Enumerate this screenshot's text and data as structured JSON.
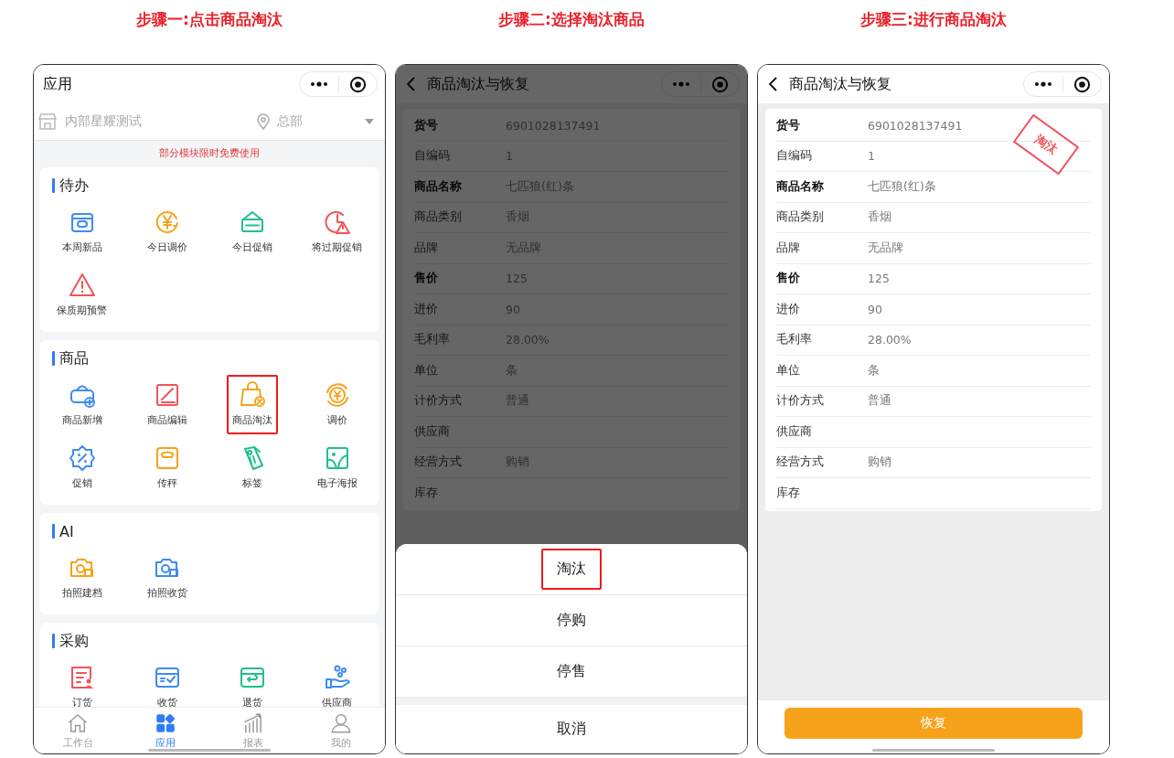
{
  "screens": [
    {
      "step_title": "步骤一:点击商品淘汰",
      "kind": "app_menu",
      "header": {
        "title": "应用"
      },
      "store": "内部星耀测试",
      "location": "总部",
      "notice": "部分模块限时免费使用",
      "sections": [
        {
          "title": "待办",
          "items": [
            {
              "label": "本周新品",
              "highlighted": false
            },
            {
              "label": "今日调价",
              "highlighted": false
            },
            {
              "label": "今日促销",
              "highlighted": false
            },
            {
              "label": "将过期促销",
              "highlighted": false
            },
            {
              "label": "保质期预警",
              "highlighted": false
            }
          ]
        },
        {
          "title": "商品",
          "items": [
            {
              "label": "商品新增",
              "highlighted": false
            },
            {
              "label": "商品编辑",
              "highlighted": false
            },
            {
              "label": "商品淘汰",
              "highlighted": true
            },
            {
              "label": "调价",
              "highlighted": false
            },
            {
              "label": "促销",
              "highlighted": false
            },
            {
              "label": "传秤",
              "highlighted": false
            },
            {
              "label": "标签",
              "highlighted": false
            },
            {
              "label": "电子海报",
              "highlighted": false
            }
          ]
        },
        {
          "title": "AI",
          "items": [
            {
              "label": "拍照建档",
              "highlighted": false
            },
            {
              "label": "拍照收货",
              "highlighted": false
            }
          ]
        },
        {
          "title": "采购",
          "items": [
            {
              "label": "订货",
              "highlighted": false
            },
            {
              "label": "收货",
              "highlighted": false
            },
            {
              "label": "退货",
              "highlighted": false
            },
            {
              "label": "供应商",
              "highlighted": false
            }
          ]
        }
      ],
      "tabbar": [
        {
          "label": "工作台",
          "selected": false
        },
        {
          "label": "应用",
          "selected": true
        },
        {
          "label": "报表",
          "selected": false
        },
        {
          "label": "我的",
          "selected": false
        }
      ]
    },
    {
      "step_title": "步骤二:选择淘汰商品",
      "kind": "product_detail",
      "header": {
        "title": "商品淘汰与恢复"
      },
      "dimmed": true,
      "fields": [
        {
          "label": "货号",
          "value": "6901028137491",
          "bold": true
        },
        {
          "label": "自编码",
          "value": "1",
          "bold": false
        },
        {
          "label": "商品名称",
          "value": "七匹狼(红)条",
          "bold": true
        },
        {
          "label": "商品类别",
          "value": "香烟",
          "bold": false
        },
        {
          "label": "品牌",
          "value": "无品牌",
          "bold": false
        },
        {
          "label": "售价",
          "value": "125",
          "bold": true
        },
        {
          "label": "进价",
          "value": "90",
          "bold": false
        },
        {
          "label": "毛利率",
          "value": "28.00%",
          "bold": false
        },
        {
          "label": "单位",
          "value": "条",
          "bold": false
        },
        {
          "label": "计价方式",
          "value": "普通",
          "bold": false
        },
        {
          "label": "供应商",
          "bold": false
        },
        {
          "label": "经营方式",
          "value": "购销",
          "bold": false
        },
        {
          "label": "库存",
          "bold": false
        }
      ],
      "action_sheet": {
        "actions": [
          {
            "label": "淘汰",
            "highlighted": true
          },
          {
            "label": "停购",
            "highlighted": false
          },
          {
            "label": "停售",
            "highlighted": false
          }
        ],
        "cancel": "取消"
      }
    },
    {
      "step_title": "步骤三:进行商品淘汰",
      "kind": "product_detail",
      "header": {
        "title": "商品淘汰与恢复"
      },
      "stamp": "淘汰",
      "fields": [
        {
          "label": "货号",
          "value": "6901028137491",
          "bold": true
        },
        {
          "label": "自编码",
          "value": "1",
          "bold": false
        },
        {
          "label": "商品名称",
          "value": "七匹狼(红)条",
          "bold": true
        },
        {
          "label": "商品类别",
          "value": "香烟",
          "bold": false
        },
        {
          "label": "品牌",
          "value": "无品牌",
          "bold": false
        },
        {
          "label": "售价",
          "value": "125",
          "bold": true
        },
        {
          "label": "进价",
          "value": "90",
          "bold": false
        },
        {
          "label": "毛利率",
          "value": "28.00%",
          "bold": false
        },
        {
          "label": "单位",
          "value": "条",
          "bold": false
        },
        {
          "label": "计价方式",
          "value": "普通",
          "bold": false
        },
        {
          "label": "供应商",
          "bold": false
        },
        {
          "label": "经营方式",
          "value": "购销",
          "bold": false
        },
        {
          "label": "库存",
          "bold": false
        }
      ],
      "footer_button": "恢复"
    }
  ]
}
